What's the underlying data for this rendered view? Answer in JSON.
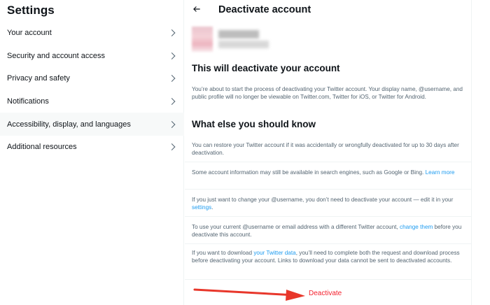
{
  "settings": {
    "title": "Settings",
    "items": [
      {
        "label": "Your account"
      },
      {
        "label": "Security and account access"
      },
      {
        "label": "Privacy and safety"
      },
      {
        "label": "Notifications"
      },
      {
        "label": "Accessibility, display, and languages"
      },
      {
        "label": "Additional resources"
      }
    ],
    "active_index": 4
  },
  "panel": {
    "title": "Deactivate account",
    "section1_heading": "This will deactivate your account",
    "section1_text": "You’re about to start the process of deactivating your Twitter account. Your display name, @username, and public profile will no longer be viewable on Twitter.com, Twitter for iOS, or Twitter for Android.",
    "section2_heading": "What else you should know",
    "info": [
      {
        "text": "You can restore your Twitter account if it was accidentally or wrongfully deactivated for up to 30 days after deactivation."
      },
      {
        "text": "Some account information may still be available in search engines, such as Google or Bing. ",
        "link": "Learn more"
      },
      {
        "text": "If you just want to change your @username, you don’t need to deactivate your account — edit it in your ",
        "link": "settings",
        "after": "."
      },
      {
        "text": "To use your current @username or email address with a different Twitter account, ",
        "link": "change them",
        "after": " before you deactivate this account."
      },
      {
        "text": "If you want to download ",
        "link": "your Twitter data",
        "after": ", you’ll need to complete both the request and download process before deactivating your account. Links to download your data cannot be sent to deactivated accounts."
      }
    ],
    "deactivate_label": "Deactivate"
  },
  "colors": {
    "accent": "#1d9bf0",
    "danger": "#f4212e",
    "annotation_arrow": "#e8372b"
  },
  "icons": {
    "back": "back-arrow-icon",
    "chevron": "chevron-right-icon"
  }
}
